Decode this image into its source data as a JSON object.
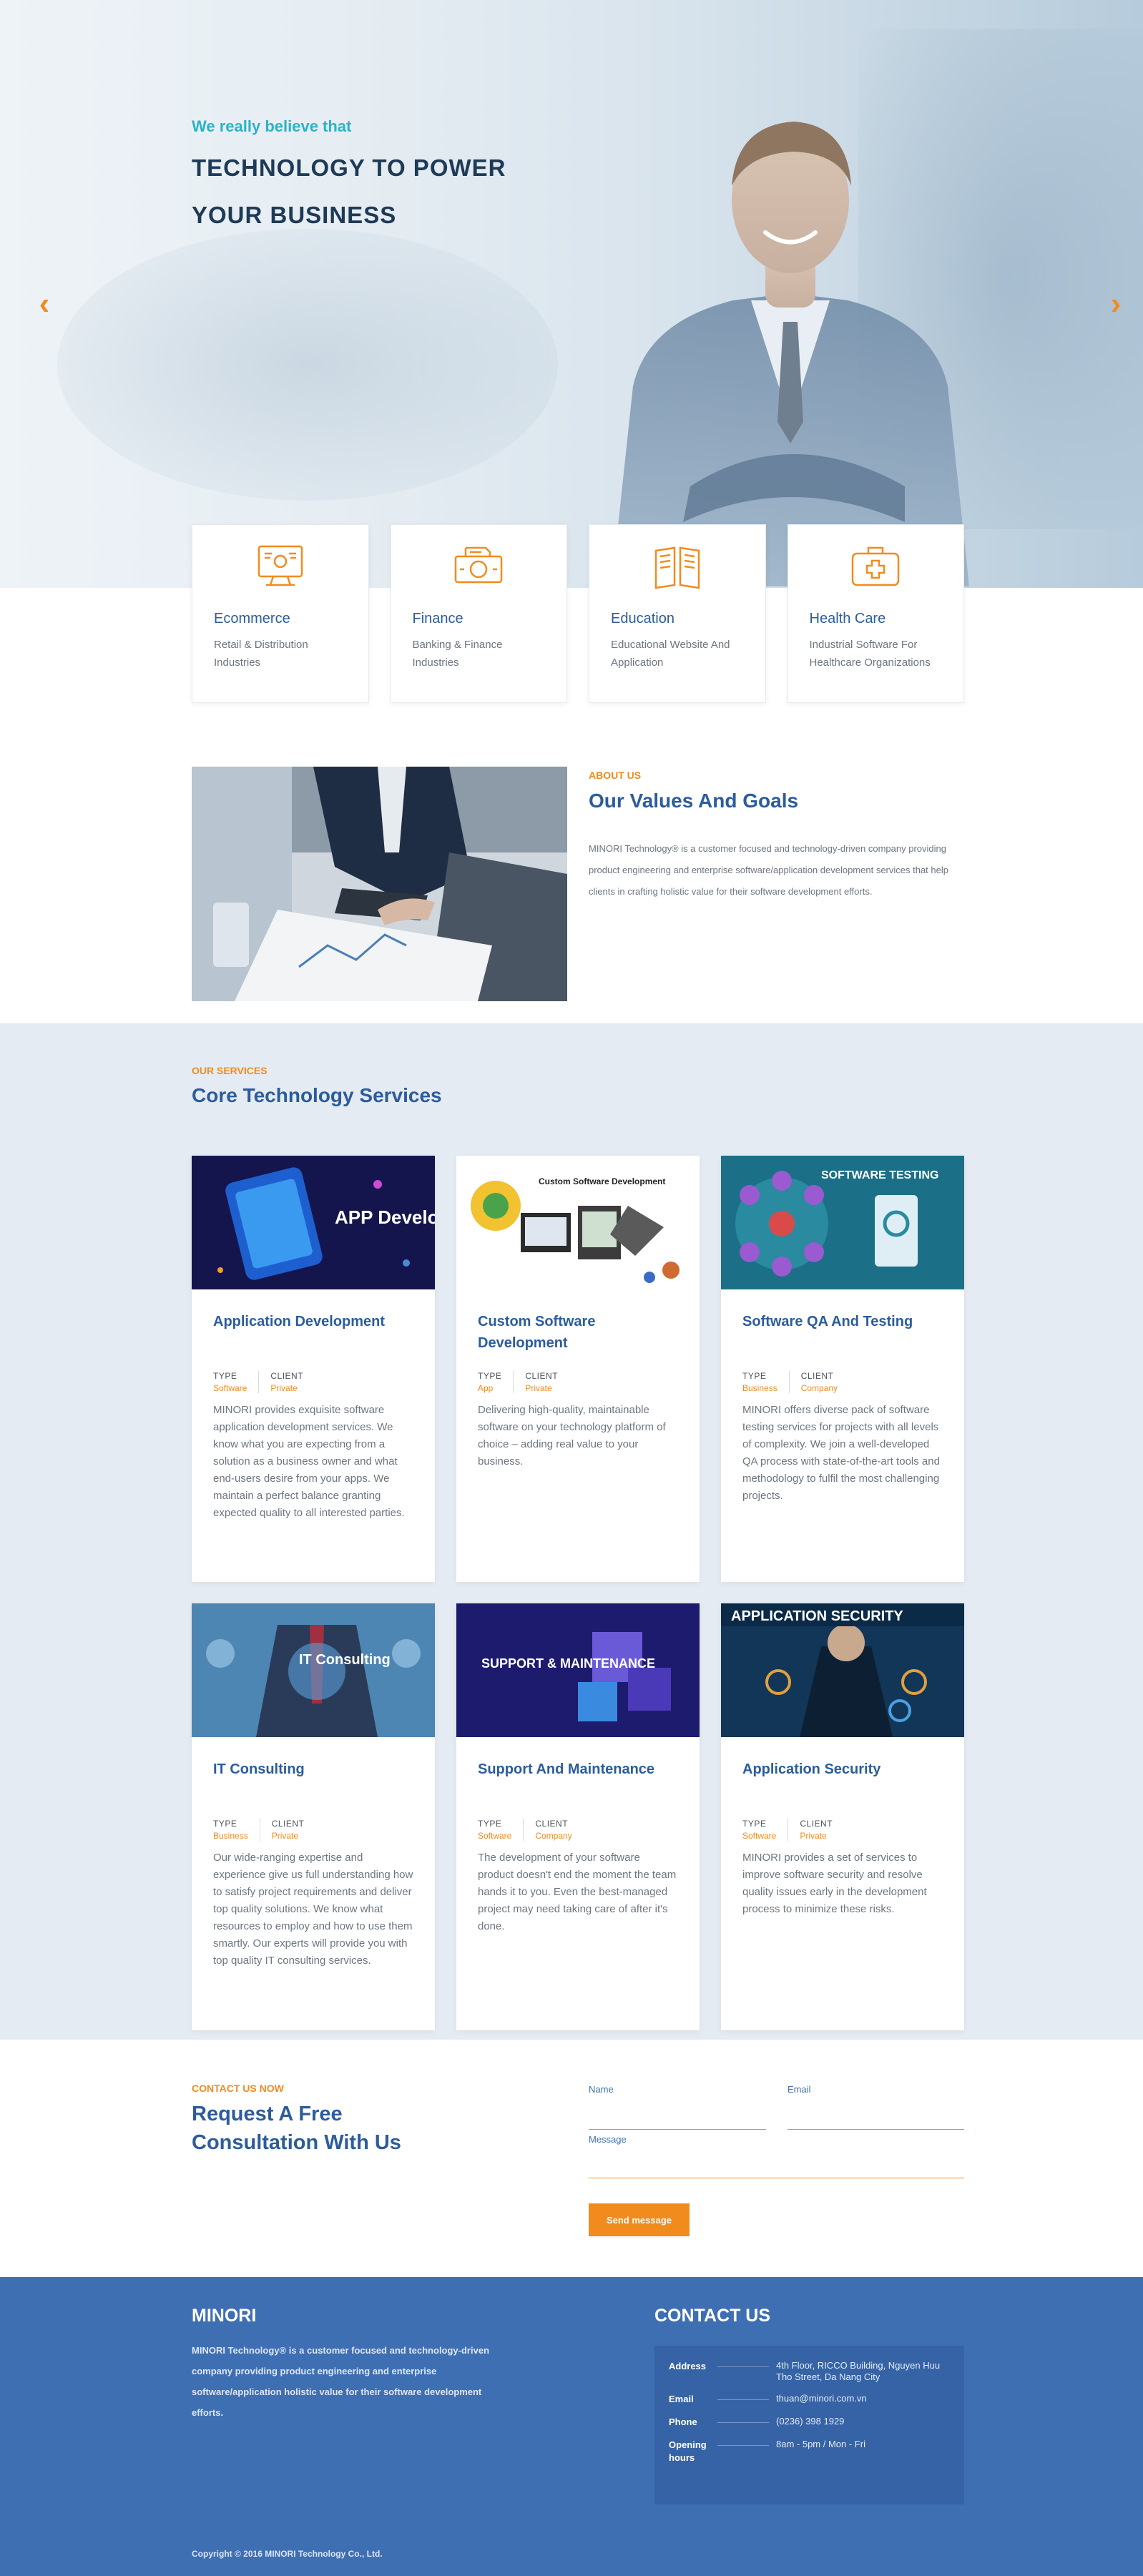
{
  "colors": {
    "accent": "#f28b1e",
    "primary": "#2c5c9c",
    "footer": "#3f6fb3",
    "kicker_teal": "#2ab3c8"
  },
  "hero": {
    "kicker": "We really believe that",
    "title_line1": "TECHNOLOGY TO POWER",
    "title_line2": "YOUR BUSINESS",
    "prev_icon": "chevron-left-icon",
    "next_icon": "chevron-right-icon"
  },
  "industries": [
    {
      "icon": "ecommerce-icon",
      "title": "Ecommerce",
      "desc": "Retail & Distribution Industries"
    },
    {
      "icon": "finance-icon",
      "title": "Finance",
      "desc": "Banking & Finance Industries"
    },
    {
      "icon": "education-icon",
      "title": "Education",
      "desc": "Educational Website And Application"
    },
    {
      "icon": "healthcare-icon",
      "title": "Health Care",
      "desc": "Industrial Software For Healthcare Organizations"
    }
  ],
  "about": {
    "kicker": "ABOUT US",
    "title": "Our Values And Goals",
    "text": "MINORI Technology® is a customer focused and technology-driven company providing product engineering and enterprise software/application development services that help clients in crafting holistic value for their software development efforts."
  },
  "services": {
    "kicker": "OUR SERVICES",
    "title": "Core Technology Services",
    "type_label": "TYPE",
    "client_label": "CLIENT",
    "items": [
      {
        "title": "Application Development",
        "type": "Software",
        "client": "Private",
        "image_text": "APP Development",
        "desc": "MINORI provides exquisite software application development services. We know what you are expecting from a solution as a business owner and what end-users desire from your apps. We maintain a perfect balance granting expected quality to all interested parties."
      },
      {
        "title": "Custom Software Development",
        "type": "App",
        "client": "Private",
        "image_text": "Custom Software Development",
        "desc": "Delivering high-quality, maintainable software on your technology platform of choice – adding real value to your business."
      },
      {
        "title": "Software QA And Testing",
        "type": "Business",
        "client": "Company",
        "image_text": "SOFTWARE   TESTING",
        "desc": "MINORI offers diverse pack of software testing services for projects with all levels of complexity. We join a well-developed QA process with state-of-the-art tools and methodology to fulfil the most challenging projects."
      },
      {
        "title": "IT Consulting",
        "type": "Business",
        "client": "Private",
        "image_text": "IT Consulting",
        "desc": "Our wide-ranging expertise and experience give us full understanding how to satisfy project requirements and deliver top quality solutions. We know what resources to employ and how to use them smartly. Our experts will provide you with top quality IT consulting services."
      },
      {
        "title": "Support And Maintenance",
        "type": "Software",
        "client": "Company",
        "image_text": "SUPPORT & MAINTENANCE",
        "desc": "The development of your software product doesn't end the moment the team hands it to you. Even the best-managed project may need taking care of after it's done."
      },
      {
        "title": "Application Security",
        "type": "Software",
        "client": "Private",
        "image_text": "APPLICATION SECURITY",
        "desc": "MINORI provides a set of services to improve software security and resolve quality issues early in the development process to minimize these risks."
      }
    ]
  },
  "contact_form": {
    "kicker": "CONTACT US NOW",
    "title": "Request A Free Consultation With Us",
    "name_label": "Name",
    "email_label": "Email",
    "message_label": "Message",
    "name_value": "",
    "email_value": "",
    "send_label": "Send message"
  },
  "footer": {
    "brand": "MINORI",
    "text": "MINORI Technology® is a customer focused and technology-driven company providing product engineering and enterprise software/application holistic value for their software development efforts.",
    "contact_title": "CONTACT US",
    "rows": [
      {
        "key": "Address",
        "value": "4th Floor, RICCO Building, Nguyen Huu Tho Street, Da Nang City"
      },
      {
        "key": "Email",
        "value": "thuan@minori.com.vn"
      },
      {
        "key": "Phone",
        "value": "(0236) 398 1929"
      },
      {
        "key": "Opening hours",
        "value": "8am - 5pm / Mon - Fri"
      }
    ],
    "copyright": "Copyright © 2016 MINORI Technology Co., Ltd."
  }
}
